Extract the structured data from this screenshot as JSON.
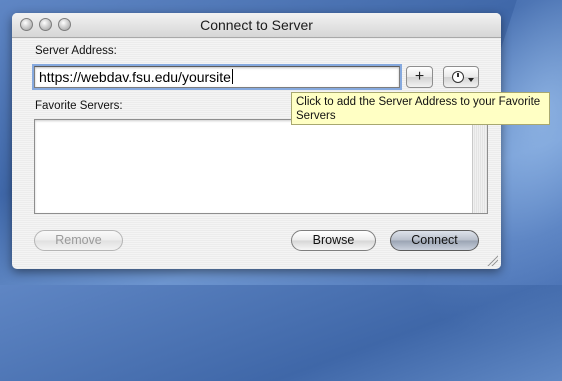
{
  "window": {
    "title": "Connect to Server"
  },
  "server_address": {
    "label": "Server Address:",
    "value": "https://webdav.fsu.edu/yoursite"
  },
  "buttons": {
    "add": "+",
    "remove": "Remove",
    "browse": "Browse",
    "connect": "Connect"
  },
  "tooltip": {
    "text": "Click to add the Server Address to your Favorite Servers"
  },
  "favorites": {
    "label": "Favorite Servers:",
    "items": []
  },
  "icons": {
    "add": "plus-icon",
    "history": "clock-icon",
    "window_controls": [
      "close-icon",
      "minimize-icon",
      "zoom-icon"
    ],
    "resize": "resize-grip-icon"
  }
}
